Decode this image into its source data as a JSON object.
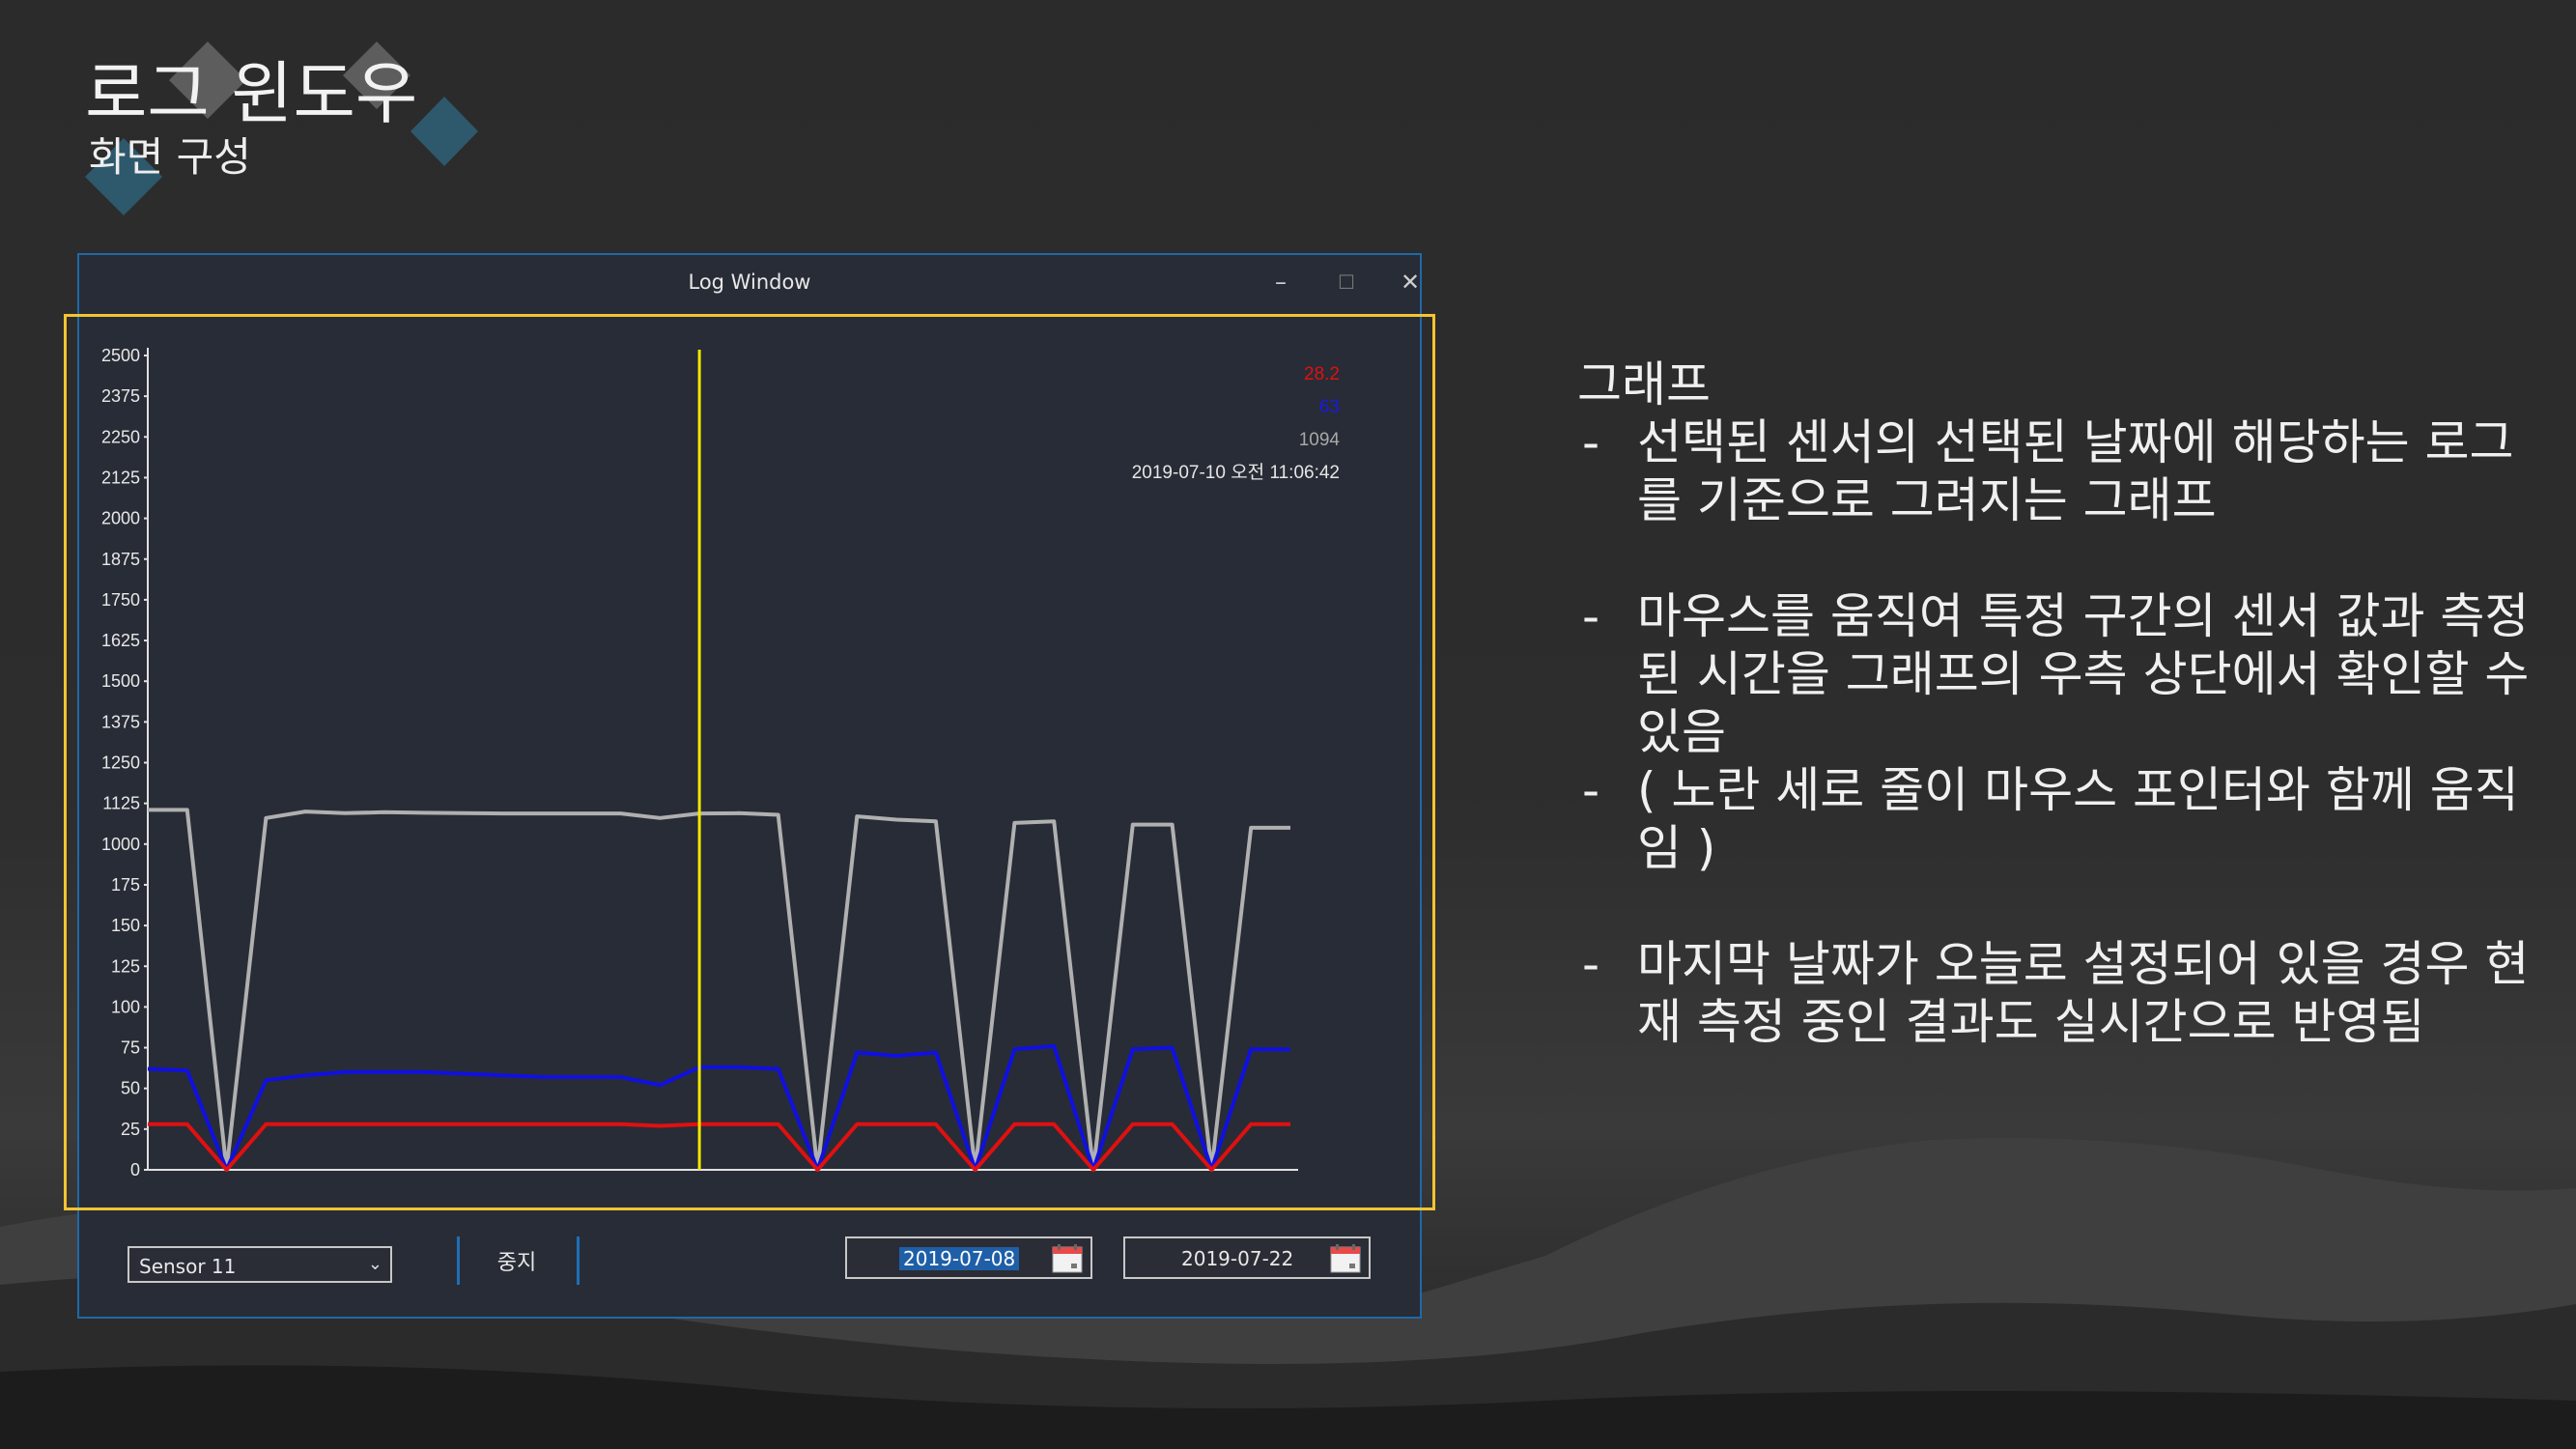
{
  "slide": {
    "title": "로그 윈도우",
    "subtitle": "화면 구성"
  },
  "window": {
    "title": "Log Window",
    "minimize_glyph": "–",
    "maximize_glyph": "☐",
    "close_glyph": "✕"
  },
  "controls": {
    "sensor_select_value": "Sensor 11",
    "stop_label": "중지",
    "start_date": "2019-07-08",
    "end_date": "2019-07-22"
  },
  "readout": {
    "value_red": "28.2",
    "value_blue": "63",
    "value_gray": "1094",
    "timestamp": "2019-07-10 오전 11:06:42"
  },
  "description": {
    "heading": "그래프",
    "bullets": [
      {
        "dash": "-",
        "text": "선택된 센서의 선택된 날짜에 해당하는 로그를 기준으로 그려지는 그래프"
      },
      {
        "dash": "-",
        "text": "마우스를 움직여 특정 구간의 센서 값과 측정된 시간을 그래프의 우측 상단에서 확인할 수 있음"
      },
      {
        "dash": "-",
        "text": "( 노란 세로 줄이 마우스 포인터와 함께 움직임 )"
      },
      {
        "dash": "-",
        "text": "마지막 날짜가 오늘로 설정되어 있을 경우 현재 측정 중인 결과도 실시간으로 반영됨"
      }
    ]
  },
  "colors": {
    "window_border": "#1d6aa8",
    "highlight_frame": "#f4c430",
    "series_gray": "#b0b0b0",
    "series_blue": "#1010e0",
    "series_red": "#e01010",
    "cursor_line": "#f2e600"
  },
  "chart_data": {
    "type": "line",
    "y_tick_labels": [
      "0",
      "25",
      "50",
      "75",
      "100",
      "125",
      "150",
      "175",
      "1000",
      "1125",
      "1250",
      "1375",
      "1500",
      "1625",
      "1750",
      "1875",
      "2000",
      "2125",
      "2250",
      "2375",
      "2500"
    ],
    "series": [
      {
        "color": "gray",
        "values": [
          1105,
          1105,
          0,
          1080,
          1100,
          1095,
          1098,
          1096,
          1095,
          1094,
          1094,
          1094,
          1094,
          1080,
          1094,
          1095,
          1090,
          0,
          1085,
          1075,
          1070,
          0,
          1065,
          1070,
          0,
          1060,
          1060,
          0,
          1050,
          1050
        ]
      },
      {
        "color": "blue",
        "values": [
          62,
          61,
          0,
          55,
          58,
          60,
          60,
          60,
          59,
          58,
          57,
          57,
          57,
          52,
          63,
          63,
          62,
          0,
          72,
          70,
          72,
          0,
          74,
          76,
          0,
          74,
          75,
          0,
          74,
          74
        ]
      },
      {
        "color": "red",
        "values": [
          28,
          28,
          0,
          28,
          28,
          28,
          28,
          28,
          28,
          28,
          28,
          28,
          28,
          27,
          28,
          28,
          28,
          0,
          28,
          28,
          28,
          0,
          28,
          28,
          0,
          28,
          28,
          0,
          28,
          28
        ]
      }
    ],
    "x_range": [
      0,
      29
    ],
    "cursor_index": 14,
    "grid": false,
    "legend": "none"
  }
}
